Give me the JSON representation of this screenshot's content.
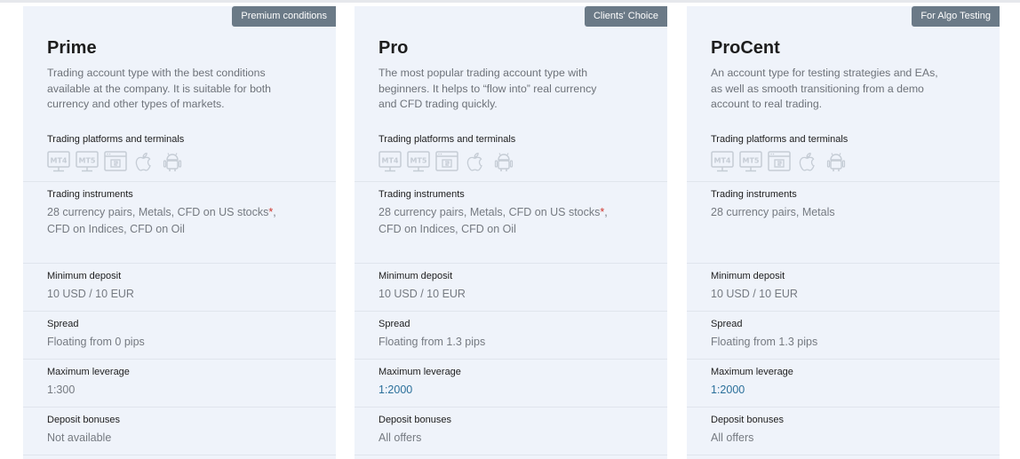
{
  "labels": {
    "platforms": "Trading platforms and terminals",
    "instruments": "Trading instruments",
    "min_deposit": "Minimum deposit",
    "spread": "Spread",
    "leverage": "Maximum leverage",
    "bonuses": "Deposit bonuses"
  },
  "cards": [
    {
      "badge": "Premium conditions",
      "title": "Prime",
      "description": "Trading account type with the best conditions available at the company. It is suitable for both currency and other types of markets.",
      "instruments_a": "28 currency pairs, Metals, CFD on US stocks",
      "instruments_star": "*",
      "instruments_b": ", CFD on Indices, CFD on Oil",
      "min_deposit": "10 USD / 10 EUR",
      "spread": "Floating from 0 pips",
      "leverage": "1:300",
      "bonuses": "Not available"
    },
    {
      "badge": "Clients' Choice",
      "title": "Pro",
      "description": "The most popular trading account type with beginners. It helps to “flow into” real currency and CFD trading quickly.",
      "instruments_a": "28 currency pairs, Metals, CFD on US stocks",
      "instruments_star": "*",
      "instruments_b": ", CFD on Indices, CFD on Oil",
      "min_deposit": "10 USD / 10 EUR",
      "spread": "Floating from 1.3 pips",
      "leverage": "1:2000",
      "bonuses": "All offers"
    },
    {
      "badge": "For Algo Testing",
      "title": "ProCent",
      "description": "An account type for testing strategies and EAs, as well as smooth transitioning from a demo account to real trading.",
      "instruments_a": "28 currency pairs, Metals",
      "instruments_star": "",
      "instruments_b": "",
      "min_deposit": "10 USD / 10 EUR",
      "spread": "Floating from 1.3 pips",
      "leverage": "1:2000",
      "bonuses": "All offers"
    }
  ],
  "platform_icons": {
    "mt4": "MT4",
    "mt5": "MT5",
    "web": "web-terminal-icon",
    "apple": "apple-icon",
    "android": "android-icon"
  },
  "colors": {
    "card_bg": "#eff3fa",
    "badge_bg": "#6b7a87",
    "link": "#2a6f9a",
    "star": "#d0342c"
  }
}
